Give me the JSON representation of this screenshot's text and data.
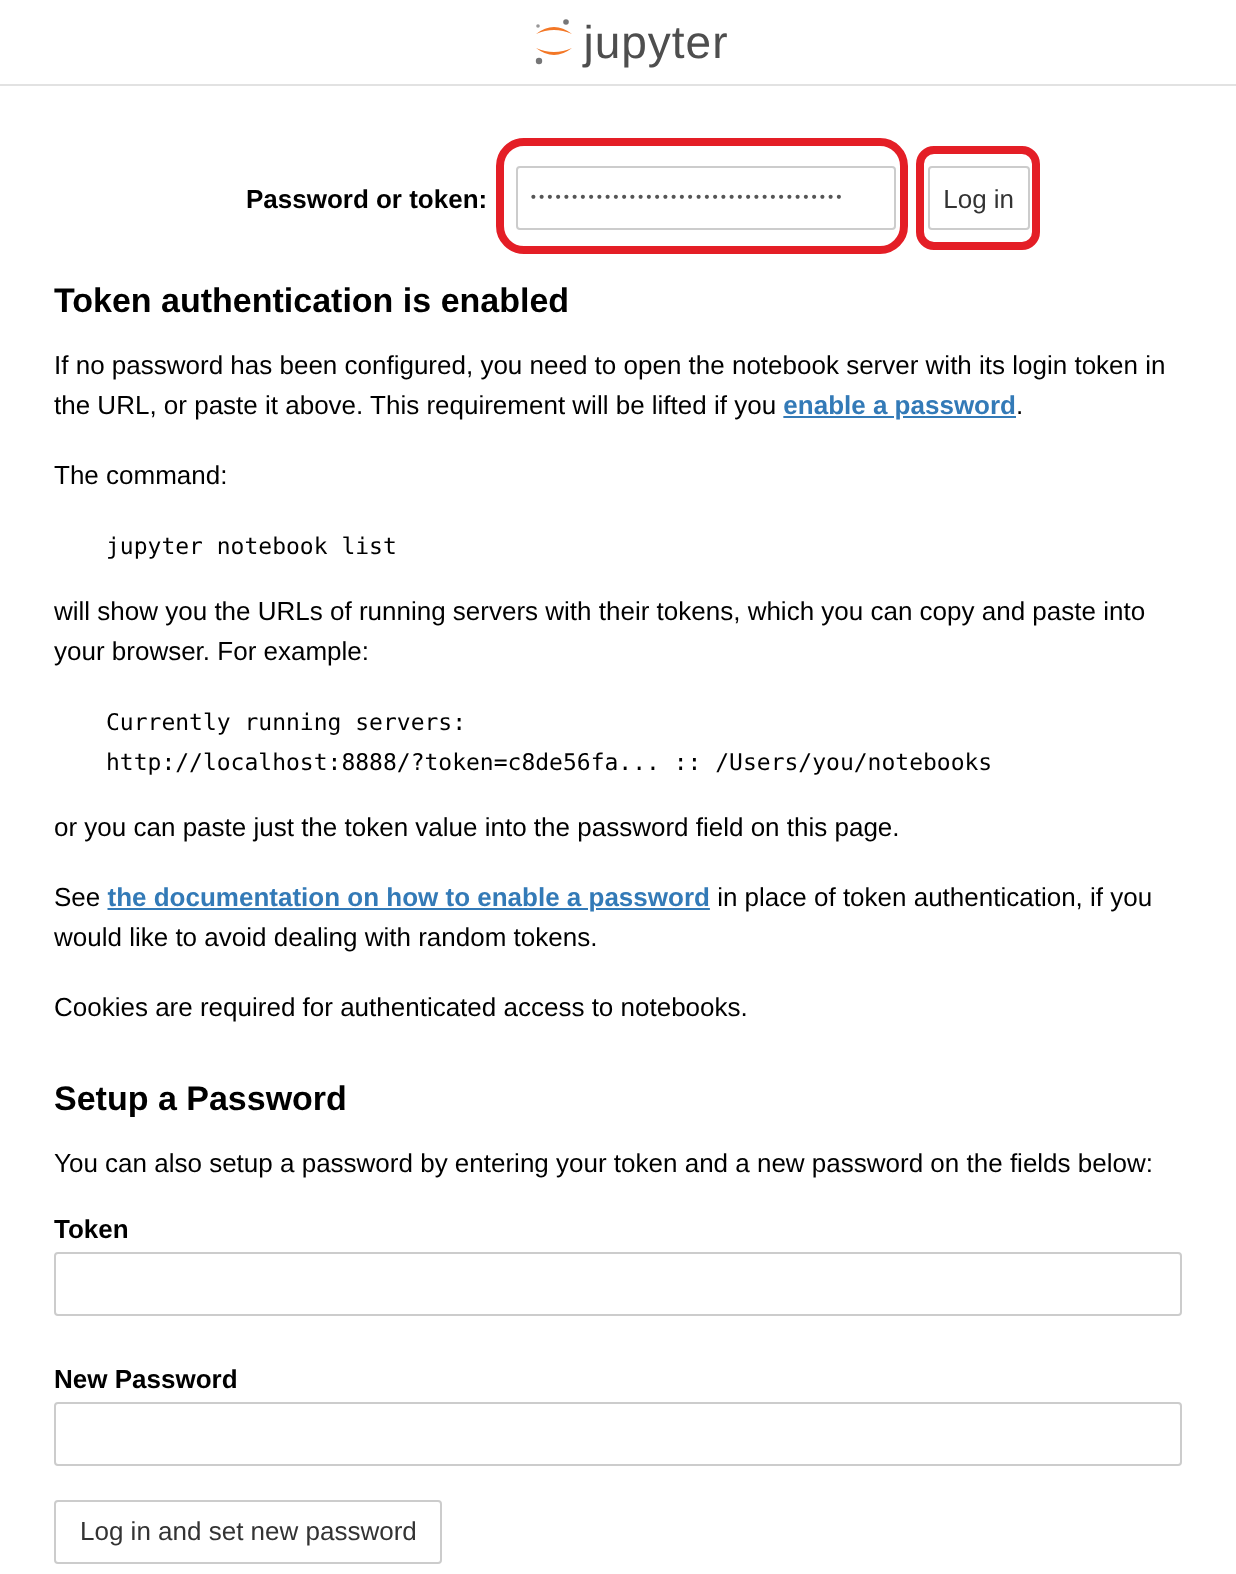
{
  "header": {
    "logo_text": "jupyter"
  },
  "login": {
    "label": "Password or token:",
    "password_field": {
      "value": "••••••••••••••••••••••••••••••••••••••",
      "highlighted": true
    },
    "login_button": {
      "label": "Log in",
      "highlighted": true
    }
  },
  "token_section": {
    "heading": "Token authentication is enabled",
    "blocks": [
      {
        "kind": "para",
        "parts": [
          {
            "text": "If no password has been configured, you need to open the notebook server with its login token in the URL, or paste it above. This requirement will be lifted if you "
          },
          {
            "link": "enable a password"
          },
          {
            "text": "."
          }
        ]
      },
      {
        "kind": "para",
        "parts": [
          {
            "text": "The command:"
          }
        ]
      },
      {
        "kind": "code",
        "lines": [
          "jupyter notebook list"
        ]
      },
      {
        "kind": "para",
        "parts": [
          {
            "text": "will show you the URLs of running servers with their tokens, which you can copy and paste into your browser. For example:"
          }
        ]
      },
      {
        "kind": "code",
        "lines": [
          "Currently running servers:",
          "http://localhost:8888/?token=c8de56fa... :: /Users/you/notebooks"
        ]
      },
      {
        "kind": "para",
        "parts": [
          {
            "text": "or you can paste just the token value into the password field on this page."
          }
        ]
      },
      {
        "kind": "para",
        "parts": [
          {
            "text": "See "
          },
          {
            "link": "the documentation on how to enable a password"
          },
          {
            "text": " in place of token authentication, if you would like to avoid dealing with random tokens."
          }
        ]
      },
      {
        "kind": "para",
        "parts": [
          {
            "text": "Cookies are required for authenticated access to notebooks."
          }
        ]
      }
    ]
  },
  "setup_section": {
    "heading": "Setup a Password",
    "intro": "You can also setup a password by entering your token and a new password on the fields below:",
    "fields": [
      {
        "label": "Token"
      },
      {
        "label": "New Password"
      }
    ],
    "button": "Log in and set new password"
  }
}
